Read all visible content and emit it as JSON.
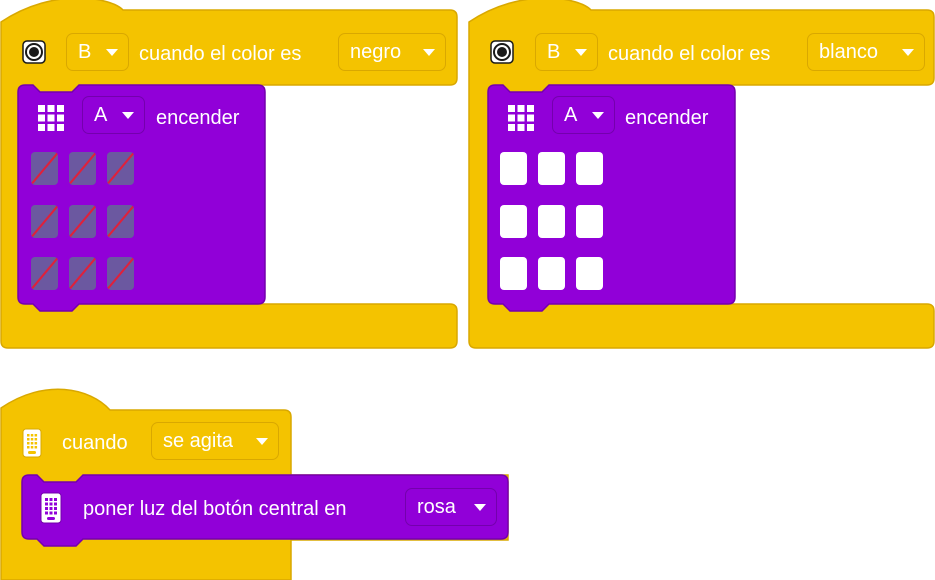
{
  "blocks": [
    {
      "hat_port": "B",
      "hat_text": "cuando el color es",
      "hat_color": "negro",
      "inner_port": "A",
      "inner_action": "encender",
      "grid_state": "off"
    },
    {
      "hat_port": "B",
      "hat_text": "cuando el color es",
      "hat_color": "blanco",
      "inner_port": "A",
      "inner_action": "encender",
      "grid_state": "on"
    }
  ],
  "shake_block": {
    "hat_text": "cuando",
    "hat_event": "se agita",
    "action_text": "poner luz del botón central en",
    "action_color": "rosa"
  },
  "icons": {
    "color_sensor": "color-sensor-icon",
    "light_matrix": "light-matrix-icon",
    "hub": "hub-icon"
  },
  "colors": {
    "event_yellow": "#f4c300",
    "event_border": "#d9a800",
    "light_purple": "#9100d8",
    "light_border": "#7400ad",
    "pixel_off": "#6b58a0",
    "pixel_on": "#ffffff"
  }
}
